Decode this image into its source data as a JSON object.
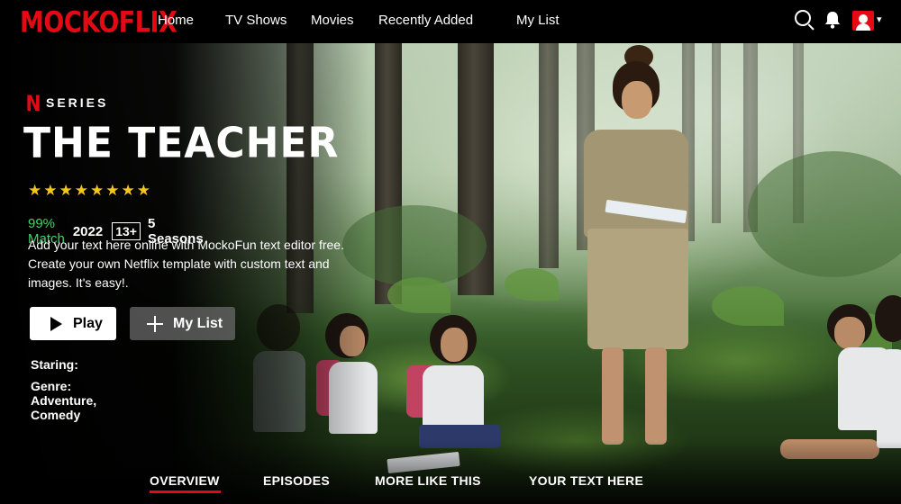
{
  "nav": {
    "logo": "MOCKOFLIX",
    "links": [
      "Home",
      "TV Shows",
      "Movies",
      "Recently Added",
      "My List"
    ],
    "icons": [
      "search-icon",
      "bell-icon",
      "avatar",
      "chevron-down-icon"
    ],
    "caret": "▾"
  },
  "hero": {
    "badge_letter": "N",
    "badge_label": "SERIES",
    "title": "THE TEACHER",
    "stars": "★★★★★★★★",
    "star_count": 8,
    "match": "99% Match",
    "year": "2022",
    "rating": "13+",
    "seasons": "5 Seasons",
    "description": "Add your text here online with MockoFun text editor free. Create your own Netflix template with custom text and images. It's easy!.",
    "play_label": "Play",
    "mylist_label": "My List",
    "staring": "Staring:",
    "genre": "Genre: Adventure, Comedy"
  },
  "tabs": [
    "OVERVIEW",
    "EPISODES",
    "MORE LIKE THIS",
    "YOUR TEXT HERE"
  ],
  "active_tab": 0,
  "colors": {
    "brand_red": "#e50914",
    "match_green": "#46d369",
    "star_gold": "#f5c518",
    "background": "#000000"
  }
}
